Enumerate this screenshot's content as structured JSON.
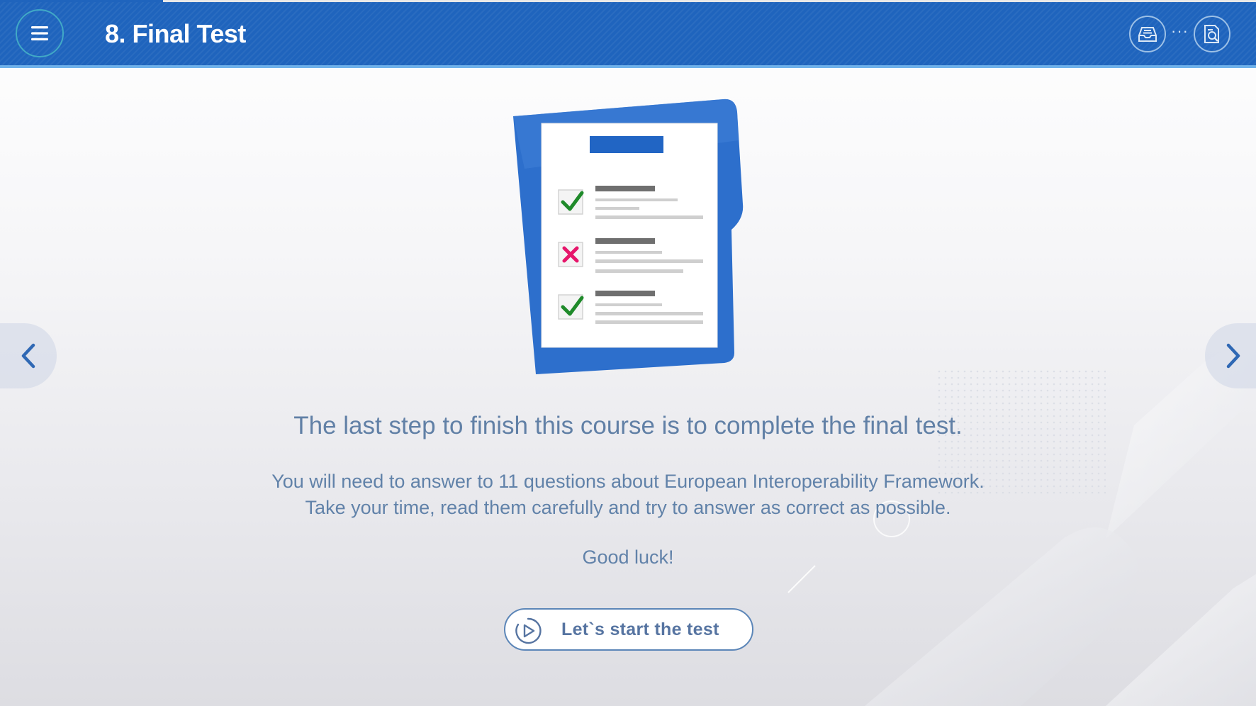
{
  "header": {
    "title": "8. Final Test",
    "menu_icon": "hamburger-menu-icon",
    "glossary_icon": "inbox-tray-icon",
    "dots": "···",
    "search_icon": "document-search-icon",
    "progress": 0.13
  },
  "navigation": {
    "prev_icon": "chevron-left-icon",
    "next_icon": "chevron-right-icon"
  },
  "content": {
    "illustration": "test-checklist-icon",
    "headline": "The last step to finish this course is to complete the final test.",
    "body_line1": "You will need to answer to 11 questions about European Interoperability Framework.",
    "body_line2": "Take your time, read them carefully and try to answer as correct as possible.",
    "good_luck": "Good luck!",
    "start_button": "Let`s start the test",
    "start_icon": "play-circle-icon"
  },
  "colors": {
    "header_blue": "#1f64bd",
    "accent_light_blue": "#6fb1ea",
    "text_blue": "#6182a9",
    "check_green": "#1f8a2a",
    "cross_pink": "#e6166b"
  }
}
